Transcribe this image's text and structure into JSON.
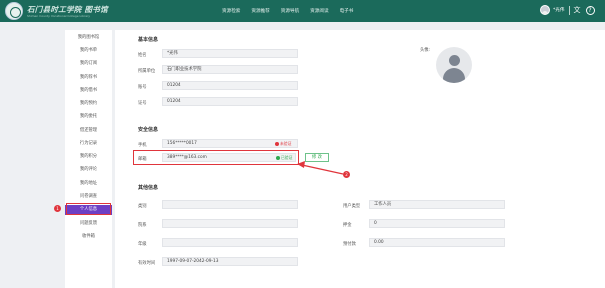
{
  "header": {
    "logo_text": "石门县时工学院 图书馆",
    "logo_subtext": "Shimen County Vocational College Library",
    "nav": [
      "资源检索",
      "资源推荐",
      "资源导航",
      "资源阅读",
      "电子书"
    ],
    "user_name": "*光伟"
  },
  "sidebar": {
    "items": [
      "我的图书馆",
      "我的书单",
      "我的订阅",
      "我的荐书",
      "我的借书",
      "我的预约",
      "我的委托",
      "借还管理",
      "行为记录",
      "我的积分",
      "我的评论",
      "我的地址",
      "问卷调查",
      "个人信息",
      "问题反馈",
      "收件箱"
    ],
    "active_index": 13
  },
  "annotations": {
    "badge1": "1",
    "badge2": "2"
  },
  "basic": {
    "title": "基本信息",
    "avatar_label": "头像:",
    "fields": [
      {
        "label": "姓名",
        "value": "*光伟"
      },
      {
        "label": "所属单位",
        "value": "石门职业技术学院"
      },
      {
        "label": "账号",
        "value": "01204"
      },
      {
        "label": "证号",
        "value": "01204"
      }
    ]
  },
  "security": {
    "title": "安全信息",
    "phone_label": "手机",
    "phone_value": "156*****0017",
    "phone_status": "未验证",
    "email_label": "邮箱",
    "email_value": "389****@163.com",
    "email_status": "已验证",
    "edit_label": "修 改"
  },
  "other": {
    "title": "其他信息",
    "left": [
      {
        "label": "类别",
        "value": ""
      },
      {
        "label": "院系",
        "value": ""
      },
      {
        "label": "年级",
        "value": ""
      },
      {
        "label": "有效时间",
        "value": "1997-09-07-2042-09-13"
      }
    ],
    "right": [
      {
        "label": "用户类型",
        "value": "工作人员"
      },
      {
        "label": "押金",
        "value": "0"
      },
      {
        "label": "预付款",
        "value": "0.00"
      }
    ]
  },
  "colors": {
    "header_bg": "#1b6a5b",
    "active_bg": "#6c3fc4",
    "highlight": "#e0353c",
    "verified": "#2fa84f"
  }
}
